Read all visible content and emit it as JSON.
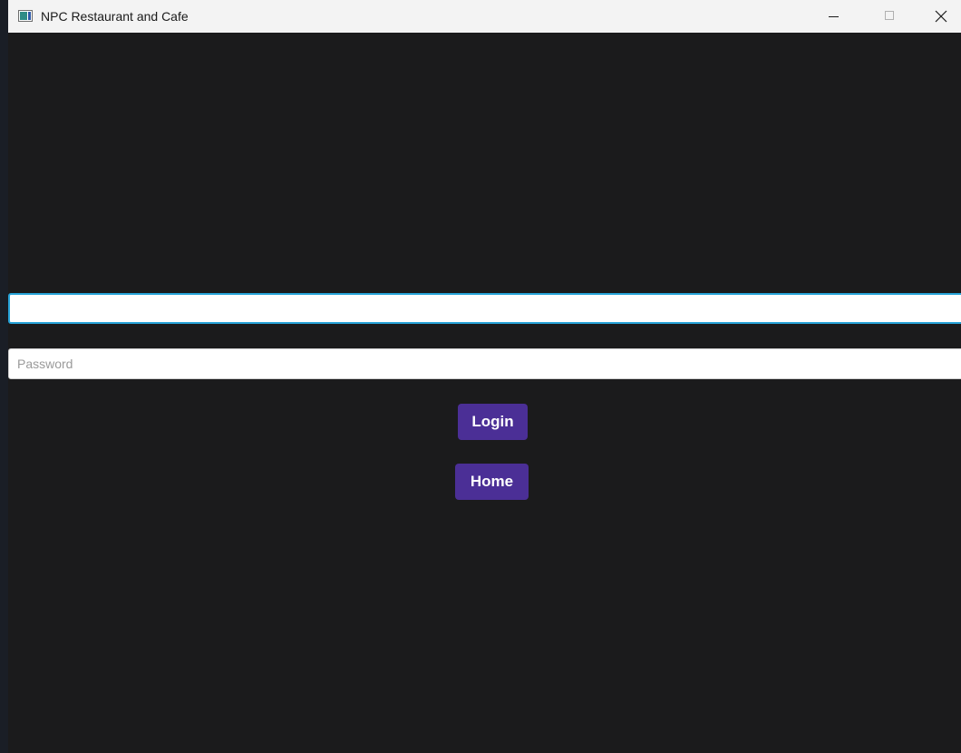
{
  "window": {
    "title": "NPC Restaurant and Cafe",
    "icon": "app-window-icon",
    "controls": {
      "minimize_icon": "minimize-icon",
      "maximize_icon": "maximize-icon",
      "close_icon": "close-icon"
    }
  },
  "form": {
    "username": {
      "value": "",
      "placeholder": ""
    },
    "password": {
      "value": "",
      "placeholder": "Password"
    },
    "login_label": "Login",
    "home_label": "Home"
  },
  "colors": {
    "background": "#1b1b1c",
    "accent_button": "#4b2f96",
    "focus_border": "#27a3d8"
  }
}
